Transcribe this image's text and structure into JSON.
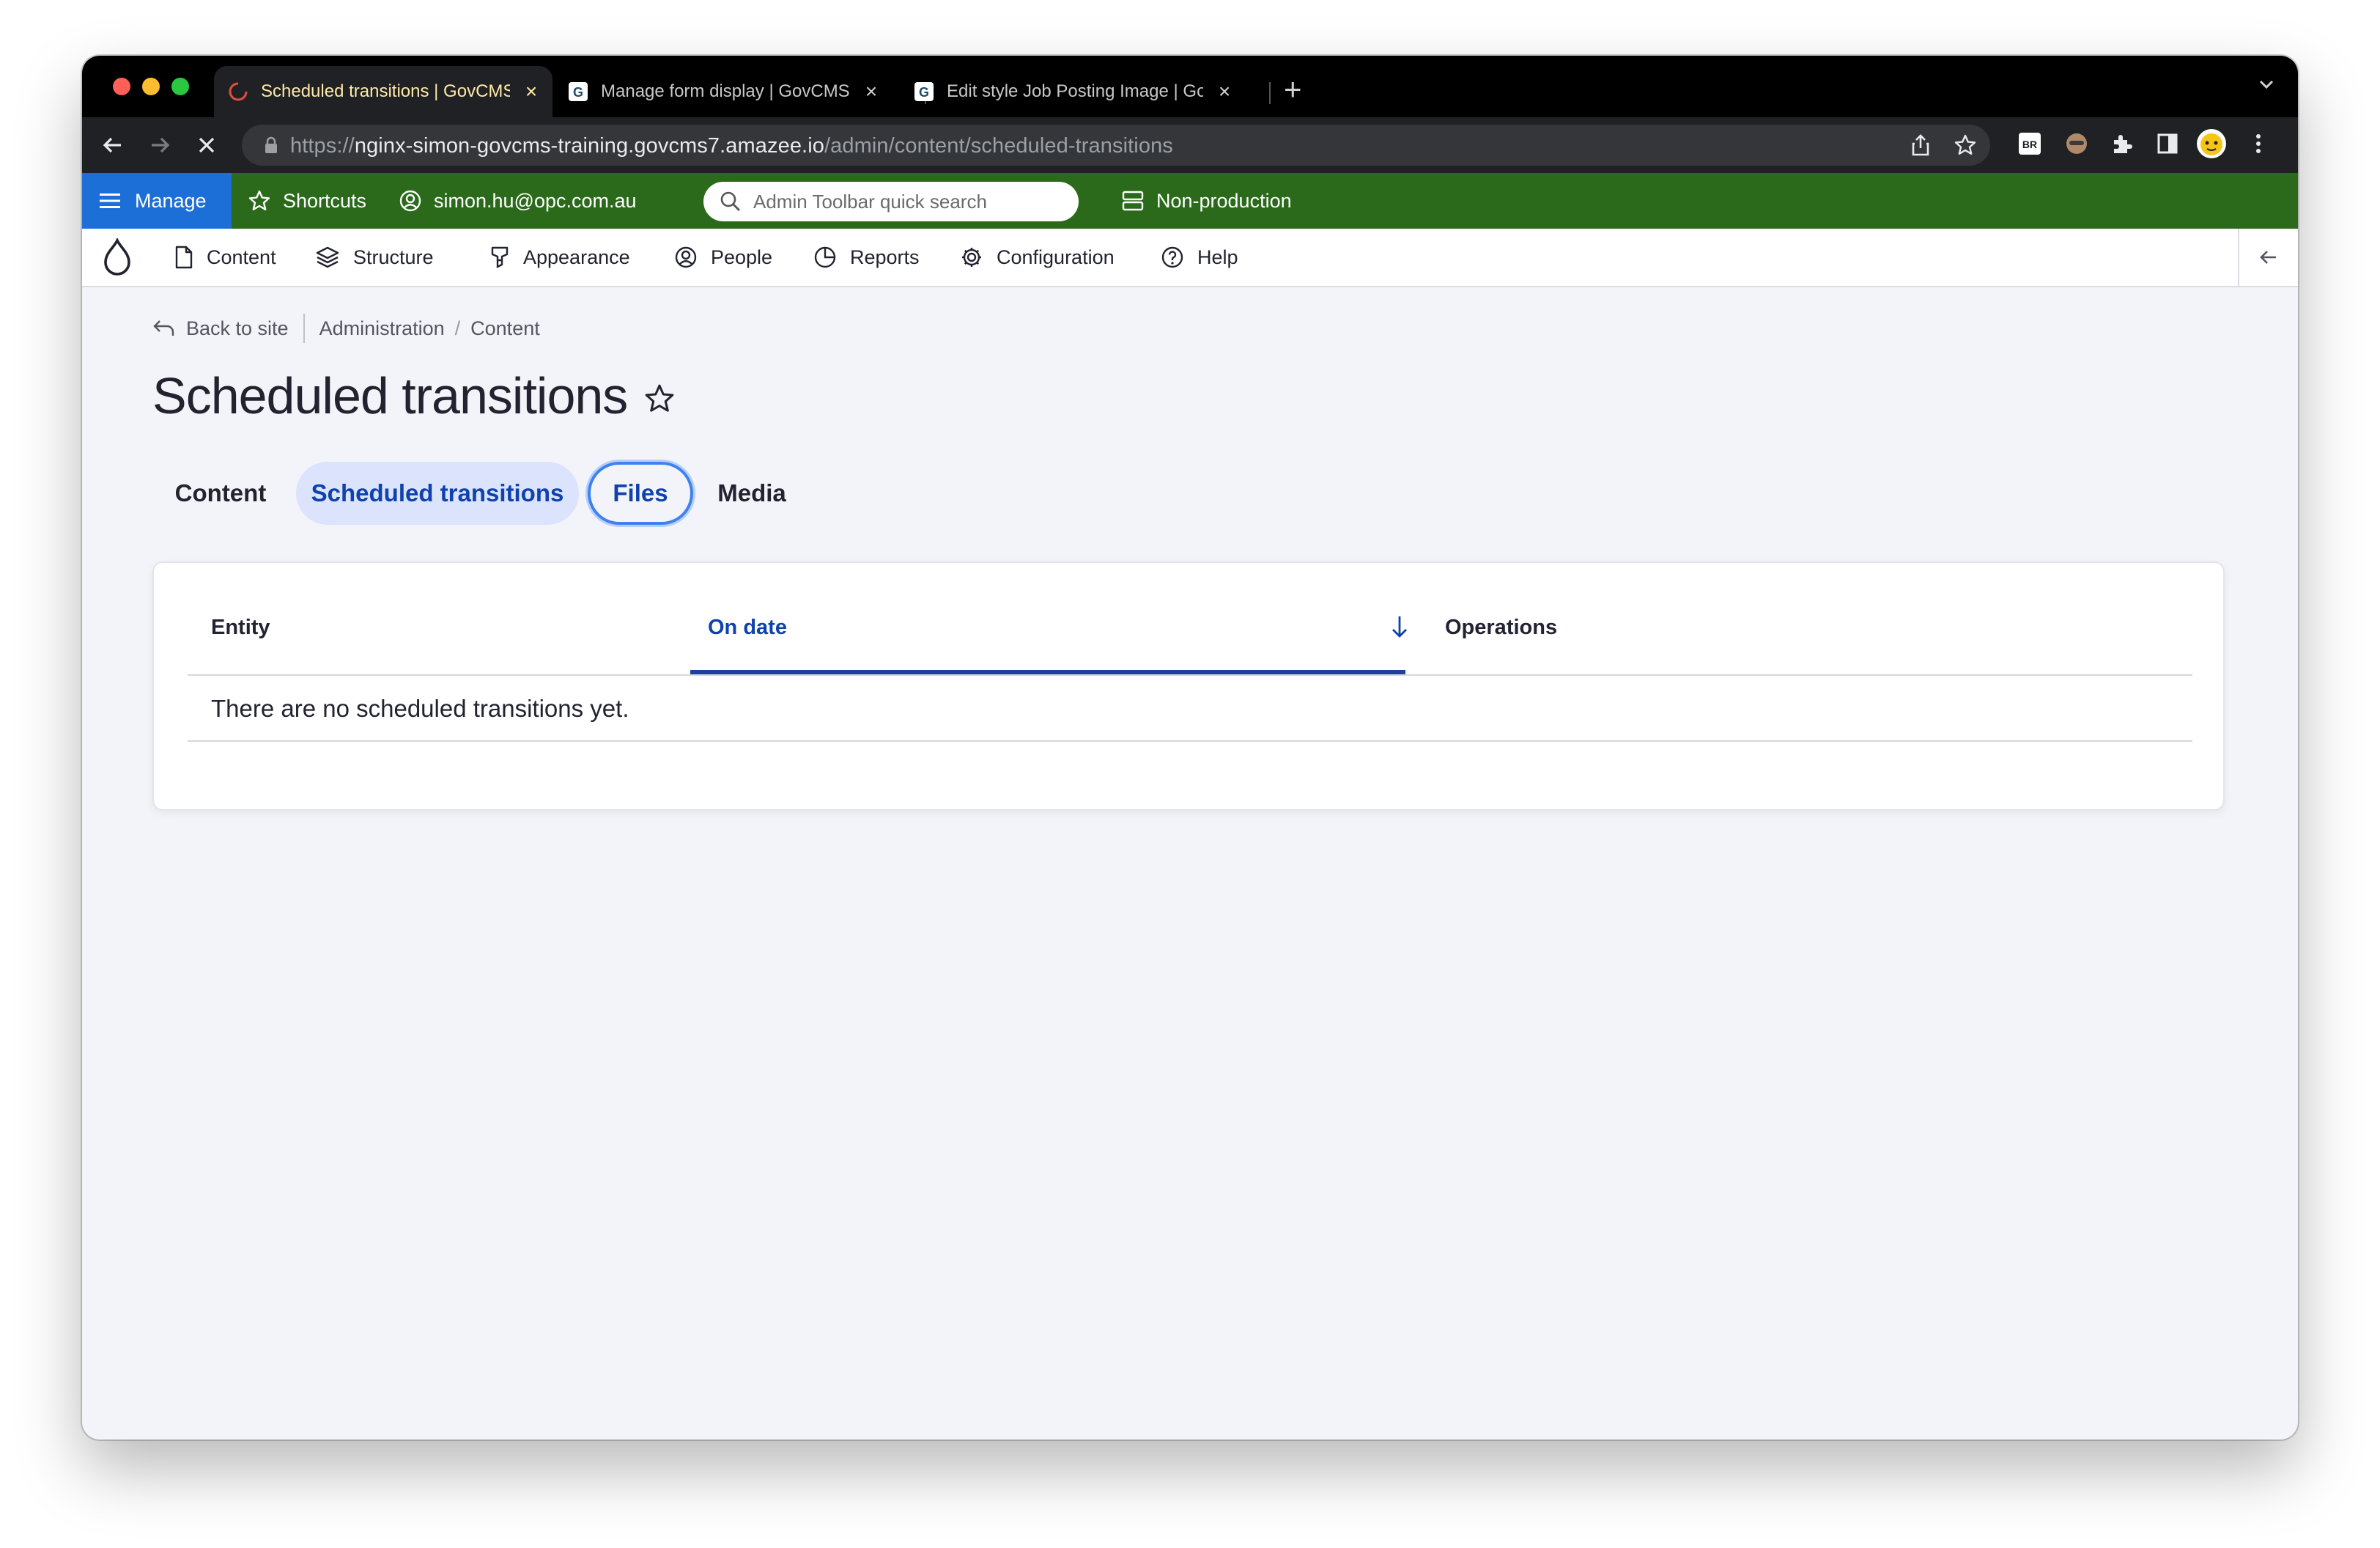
{
  "browser": {
    "tabs": [
      {
        "title": "Scheduled transitions | GovCMS",
        "active": true
      },
      {
        "title": "Manage form display | GovCMS",
        "active": false
      },
      {
        "title": "Edit style Job Posting Image | GovCMS",
        "active": false
      }
    ],
    "close_glyph": "×",
    "new_tab_glyph": "+",
    "url_scheme": "https://",
    "url_host": "nginx-simon-govcms-training.govcms7.amazee.io",
    "url_path": "/admin/content/scheduled-transitions",
    "extension_badge": "BR"
  },
  "admin_toolbar": {
    "manage": "Manage",
    "shortcuts": "Shortcuts",
    "user": "simon.hu@opc.com.au",
    "search_placeholder": "Admin Toolbar quick search",
    "environment": "Non-production"
  },
  "nav": {
    "items": [
      "Content",
      "Structure",
      "Appearance",
      "People",
      "Reports",
      "Configuration",
      "Help"
    ]
  },
  "breadcrumb": {
    "back": "Back to site",
    "items": [
      "Administration",
      "Content"
    ],
    "separator": "/"
  },
  "page": {
    "title": "Scheduled transitions",
    "tabs": [
      "Content",
      "Scheduled transitions",
      "Files",
      "Media"
    ]
  },
  "table": {
    "columns": [
      "Entity",
      "On date",
      "Operations"
    ],
    "empty_message": "There are no scheduled transitions yet."
  },
  "colors": {
    "admin_toolbar": "#2a6a1a",
    "manage": "#1d6fd8",
    "accent": "#0f42ad",
    "active_tab_bg": "#dbe3fd"
  }
}
